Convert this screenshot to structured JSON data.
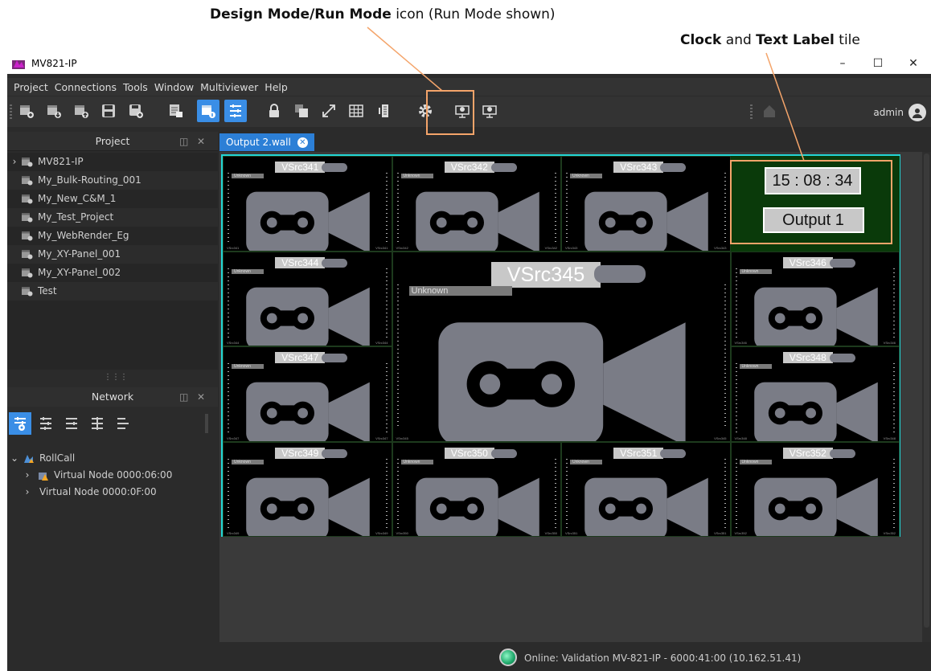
{
  "annotations": {
    "design_mode_bold": "Design Mode/Run Mode",
    "design_mode_rest": " icon (Run Mode shown)",
    "clock_bold1": "Clock",
    "clock_mid": " and ",
    "clock_bold2": "Text Label",
    "clock_rest": " tile",
    "highlight_color": "#f4a46a"
  },
  "window": {
    "title": "MV821-IP",
    "controls": [
      "–",
      "☐",
      "✕"
    ]
  },
  "menu": [
    "Project",
    "Connections",
    "Tools",
    "Window",
    "Multiviewer",
    "Help"
  ],
  "toolbar": {
    "user": "admin"
  },
  "project_panel": {
    "title": "Project",
    "items": [
      "MV821-IP",
      "My_Bulk-Routing_001",
      "My_New_C&M_1",
      "My_Test_Project",
      "My_WebRender_Eg",
      "My_XY-Panel_001",
      "My_XY-Panel_002",
      "Test"
    ]
  },
  "network_panel": {
    "title": "Network",
    "tree": [
      {
        "label": "RollCall"
      },
      {
        "label": "Virtual Node 0000:06:00"
      },
      {
        "label": "Virtual Node 0000:0F:00"
      }
    ]
  },
  "tab": {
    "label": "Output 2.wall"
  },
  "wall": {
    "accent": "#23d5d5",
    "unknown_label": "Unknown",
    "tiles": [
      {
        "name": "VSrc341"
      },
      {
        "name": "VSrc342"
      },
      {
        "name": "VSrc343"
      },
      {
        "name": "VSrc344"
      },
      {
        "name": "VSrc345"
      },
      {
        "name": "VSrc346"
      },
      {
        "name": "VSrc347"
      },
      {
        "name": "VSrc348"
      },
      {
        "name": "VSrc349"
      },
      {
        "name": "VSrc350"
      },
      {
        "name": "VSrc351"
      },
      {
        "name": "VSrc352"
      }
    ],
    "clock": "15 : 08 : 34",
    "text_label": "Output 1"
  },
  "status": {
    "text": "Online: Validation MV-821-IP - 6000:41:00 (10.162.51.41)",
    "color": "#1fa86b"
  }
}
